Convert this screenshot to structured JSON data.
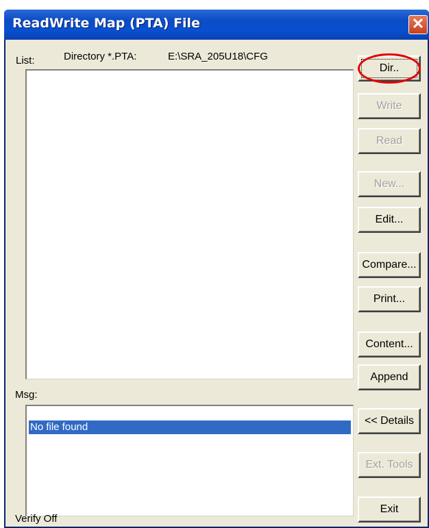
{
  "window": {
    "title": "ReadWrite Map (PTA)  File",
    "close_glyph": "✕"
  },
  "list": {
    "label": "List:",
    "directory_label": "Directory *.PTA:",
    "directory_value": "E:\\SRA_205U18\\CFG"
  },
  "msg": {
    "label": "Msg:",
    "items": [
      "No file found"
    ]
  },
  "status": {
    "verify": "Verify Off"
  },
  "buttons": {
    "dir": "Dir..",
    "write": "Write",
    "read": "Read",
    "new": "New...",
    "edit": "Edit...",
    "compare": "Compare...",
    "print": "Print...",
    "content": "Content...",
    "append": "Append",
    "details": "<< Details",
    "ext_tools": "Ext. Tools",
    "exit": "Exit"
  },
  "colors": {
    "title_bar": "#0c4cc6",
    "selection": "#316ac5",
    "highlight_circle": "#e10000",
    "close_button": "#c8401c"
  }
}
